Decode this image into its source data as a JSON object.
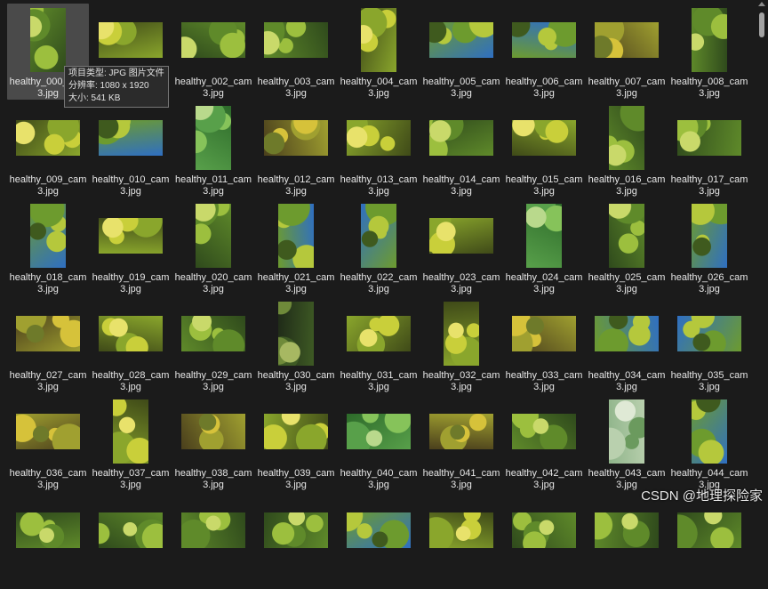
{
  "tooltip": {
    "type_line": "项目类型: JPG 图片文件",
    "resolution_line": "分辨率: 1080 x 1920",
    "size_line": "大小: 541 KB"
  },
  "watermark": "CSDN @地理探险家",
  "files": [
    {
      "name": "healthy_000_cam3.jpg",
      "orientation": "portrait",
      "palette": "green"
    },
    {
      "name": "healthy_001_cam3.jpg",
      "orientation": "landscape",
      "palette": "yellow"
    },
    {
      "name": "healthy_002_cam3.jpg",
      "orientation": "landscape",
      "palette": "green"
    },
    {
      "name": "healthy_003_cam3.jpg",
      "orientation": "landscape",
      "palette": "green"
    },
    {
      "name": "healthy_004_cam3.jpg",
      "orientation": "portrait",
      "palette": "yellow"
    },
    {
      "name": "healthy_005_cam3.jpg",
      "orientation": "landscape",
      "palette": "sky"
    },
    {
      "name": "healthy_006_cam3.jpg",
      "orientation": "landscape",
      "palette": "sky"
    },
    {
      "name": "healthy_007_cam3.jpg",
      "orientation": "landscape",
      "palette": "gold"
    },
    {
      "name": "healthy_008_cam3.jpg",
      "orientation": "portrait",
      "palette": "green"
    },
    {
      "name": "healthy_009_cam3.jpg",
      "orientation": "landscape",
      "palette": "yellow"
    },
    {
      "name": "healthy_010_cam3.jpg",
      "orientation": "landscape",
      "palette": "sky"
    },
    {
      "name": "healthy_011_cam3.jpg",
      "orientation": "portrait",
      "palette": "leaf"
    },
    {
      "name": "healthy_012_cam3.jpg",
      "orientation": "landscape",
      "palette": "gold"
    },
    {
      "name": "healthy_013_cam3.jpg",
      "orientation": "landscape",
      "palette": "yellow"
    },
    {
      "name": "healthy_014_cam3.jpg",
      "orientation": "landscape",
      "palette": "green"
    },
    {
      "name": "healthy_015_cam3.jpg",
      "orientation": "landscape",
      "palette": "yellow"
    },
    {
      "name": "healthy_016_cam3.jpg",
      "orientation": "portrait",
      "palette": "green"
    },
    {
      "name": "healthy_017_cam3.jpg",
      "orientation": "landscape",
      "palette": "green"
    },
    {
      "name": "healthy_018_cam3.jpg",
      "orientation": "portrait",
      "palette": "sky"
    },
    {
      "name": "healthy_019_cam3.jpg",
      "orientation": "landscape",
      "palette": "yellow"
    },
    {
      "name": "healthy_020_cam3.jpg",
      "orientation": "portrait",
      "palette": "green"
    },
    {
      "name": "healthy_021_cam3.jpg",
      "orientation": "portrait",
      "palette": "sky"
    },
    {
      "name": "healthy_022_cam3.jpg",
      "orientation": "portrait",
      "palette": "sky"
    },
    {
      "name": "healthy_023_cam3.jpg",
      "orientation": "landscape",
      "palette": "yellow"
    },
    {
      "name": "healthy_024_cam3.jpg",
      "orientation": "portrait",
      "palette": "leaf"
    },
    {
      "name": "healthy_025_cam3.jpg",
      "orientation": "portrait",
      "palette": "green"
    },
    {
      "name": "healthy_026_cam3.jpg",
      "orientation": "portrait",
      "palette": "sky"
    },
    {
      "name": "healthy_027_cam3.jpg",
      "orientation": "landscape",
      "palette": "gold"
    },
    {
      "name": "healthy_028_cam3.jpg",
      "orientation": "landscape",
      "palette": "yellow"
    },
    {
      "name": "healthy_029_cam3.jpg",
      "orientation": "landscape",
      "palette": "green"
    },
    {
      "name": "healthy_030_cam3.jpg",
      "orientation": "portrait",
      "palette": "dark"
    },
    {
      "name": "healthy_031_cam3.jpg",
      "orientation": "landscape",
      "palette": "yellow"
    },
    {
      "name": "healthy_032_cam3.jpg",
      "orientation": "portrait",
      "palette": "yellow"
    },
    {
      "name": "healthy_033_cam3.jpg",
      "orientation": "landscape",
      "palette": "gold"
    },
    {
      "name": "healthy_034_cam3.jpg",
      "orientation": "landscape",
      "palette": "sky"
    },
    {
      "name": "healthy_035_cam3.jpg",
      "orientation": "landscape",
      "palette": "sky"
    },
    {
      "name": "healthy_036_cam3.jpg",
      "orientation": "landscape",
      "palette": "gold"
    },
    {
      "name": "healthy_037_cam3.jpg",
      "orientation": "portrait",
      "palette": "yellow"
    },
    {
      "name": "healthy_038_cam3.jpg",
      "orientation": "landscape",
      "palette": "gold"
    },
    {
      "name": "healthy_039_cam3.jpg",
      "orientation": "landscape",
      "palette": "yellow"
    },
    {
      "name": "healthy_040_cam3.jpg",
      "orientation": "landscape",
      "palette": "leaf"
    },
    {
      "name": "healthy_041_cam3.jpg",
      "orientation": "landscape",
      "palette": "gold"
    },
    {
      "name": "healthy_042_cam3.jpg",
      "orientation": "landscape",
      "palette": "green"
    },
    {
      "name": "healthy_043_cam3.jpg",
      "orientation": "portrait",
      "palette": "pale"
    },
    {
      "name": "healthy_044_cam3.jpg",
      "orientation": "portrait",
      "palette": "sky"
    },
    {
      "name": "",
      "orientation": "landscape",
      "palette": "green"
    },
    {
      "name": "",
      "orientation": "landscape",
      "palette": "green"
    },
    {
      "name": "",
      "orientation": "landscape",
      "palette": "green"
    },
    {
      "name": "",
      "orientation": "landscape",
      "palette": "green"
    },
    {
      "name": "",
      "orientation": "landscape",
      "palette": "sky"
    },
    {
      "name": "",
      "orientation": "landscape",
      "palette": "yellow"
    },
    {
      "name": "",
      "orientation": "landscape",
      "palette": "green"
    },
    {
      "name": "",
      "orientation": "landscape",
      "palette": "green"
    },
    {
      "name": "",
      "orientation": "landscape",
      "palette": "green"
    }
  ],
  "hovered_file": "healthy_000_cam3.jpg",
  "palettes": {
    "green": [
      "#2f4a1c",
      "#5f8a2a",
      "#9cbf3e",
      "#c9d96a"
    ],
    "yellow": [
      "#3f4a18",
      "#8aa62c",
      "#c9cf3a",
      "#e8e26b"
    ],
    "sky": [
      "#2f6fc2",
      "#6d9b2e",
      "#b5c83c",
      "#3f5a1e"
    ],
    "gold": [
      "#4a3f1c",
      "#a0a030",
      "#d6c23a",
      "#6e7a2a"
    ],
    "leaf": [
      "#2d6a2a",
      "#58a04a",
      "#86c35a",
      "#b9d98c"
    ],
    "dark": [
      "#1f2a18",
      "#3e5a24",
      "#6f8a3a",
      "#a7b862"
    ],
    "pale": [
      "#8fb48a",
      "#b9d0ae",
      "#6b9a5e",
      "#dfe9d5"
    ]
  }
}
